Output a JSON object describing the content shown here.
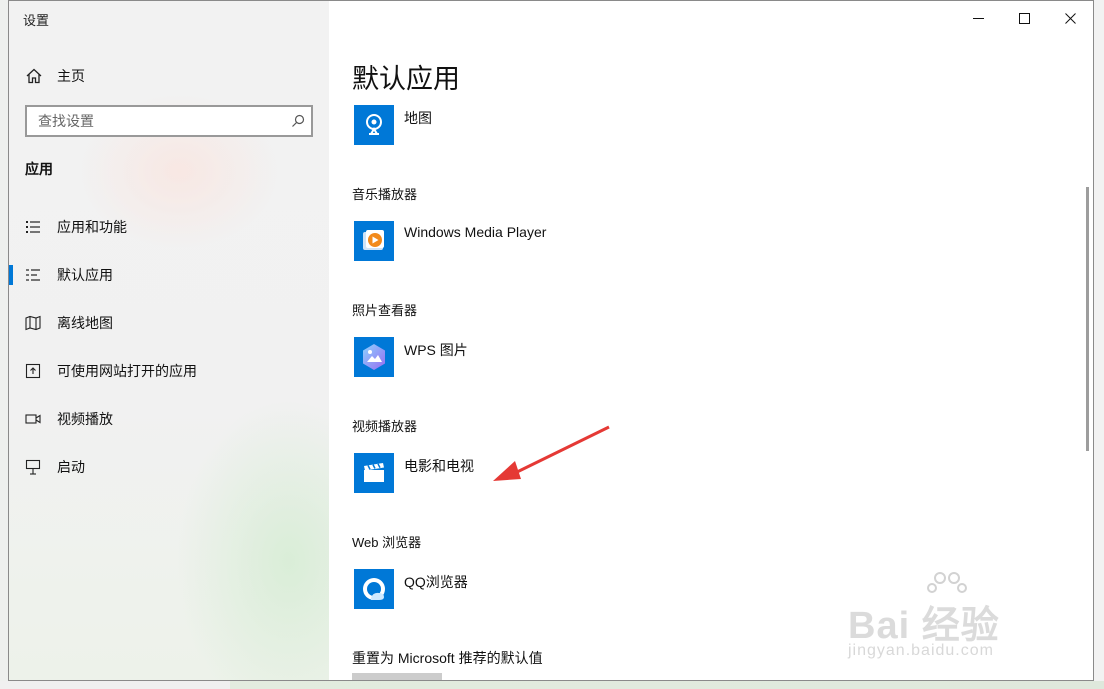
{
  "window": {
    "title": "设置",
    "controls": [
      "minimize-icon",
      "maximize-icon",
      "close-icon"
    ]
  },
  "sidebar": {
    "home_label": "主页",
    "search_placeholder": "查找设置",
    "section_heading": "应用",
    "items": [
      {
        "label": "应用和功能",
        "icon": "apps-list-icon",
        "active": false
      },
      {
        "label": "默认应用",
        "icon": "default-apps-icon",
        "active": true
      },
      {
        "label": "离线地图",
        "icon": "offline-map-icon",
        "active": false
      },
      {
        "label": "可使用网站打开的应用",
        "icon": "website-apps-icon",
        "active": false
      },
      {
        "label": "视频播放",
        "icon": "video-playback-icon",
        "active": false
      },
      {
        "label": "启动",
        "icon": "startup-icon",
        "active": false
      }
    ]
  },
  "main": {
    "page_title": "默认应用",
    "defaults": [
      {
        "category": "",
        "app": "地图",
        "icon": "maps-app-icon"
      },
      {
        "category": "音乐播放器",
        "app": "Windows Media Player",
        "icon": "windows-media-player-icon"
      },
      {
        "category": "照片查看器",
        "app": "WPS 图片",
        "icon": "wps-pictures-icon"
      },
      {
        "category": "视频播放器",
        "app": "电影和电视",
        "icon": "movies-tv-icon"
      },
      {
        "category": "Web 浏览器",
        "app": "QQ浏览器",
        "icon": "qq-browser-icon"
      }
    ],
    "reset_label": "重置为 Microsoft 推荐的默认值"
  },
  "watermark": {
    "brand": "Bai 经验",
    "url": "jingyan.baidu.com"
  },
  "colors": {
    "accent": "#0078d7",
    "annotation_arrow": "#e53935"
  }
}
